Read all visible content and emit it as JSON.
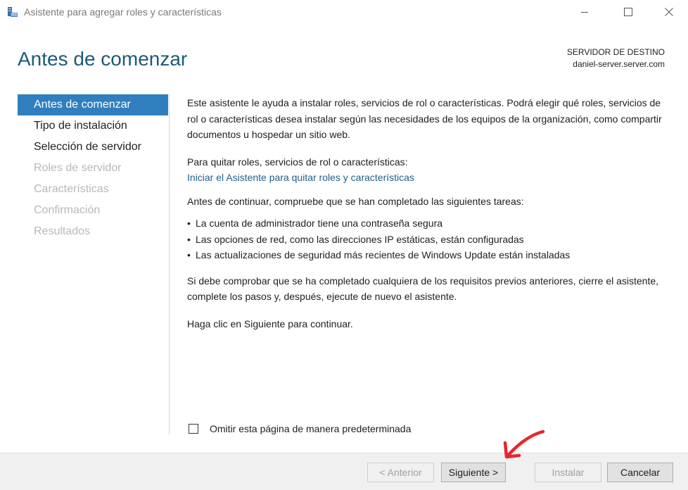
{
  "window": {
    "title": "Asistente para agregar roles y características",
    "icon": "server-manager-icon",
    "controls": [
      "minimize-icon",
      "maximize-icon",
      "close-icon"
    ]
  },
  "header": {
    "heading": "Antes de comenzar",
    "destination_label": "SERVIDOR DE DESTINO",
    "destination_server": "daniel-server.server.com"
  },
  "nav": {
    "items": [
      {
        "label": "Antes de comenzar",
        "state": "active"
      },
      {
        "label": "Tipo de instalación",
        "state": "enabled"
      },
      {
        "label": "Selección de servidor",
        "state": "enabled"
      },
      {
        "label": "Roles de servidor",
        "state": "disabled"
      },
      {
        "label": "Características",
        "state": "disabled"
      },
      {
        "label": "Confirmación",
        "state": "disabled"
      },
      {
        "label": "Resultados",
        "state": "disabled"
      }
    ]
  },
  "content": {
    "intro": "Este asistente le ayuda a instalar roles, servicios de rol o características. Podrá elegir qué roles, servicios de rol o características desea instalar según las necesidades de los equipos de la organización, como compartir documentos u hospedar un sitio web.",
    "remove_text": "Para quitar roles, servicios de rol o características:",
    "remove_link": "Iniciar el Asistente para quitar roles y características",
    "before_text": "Antes de continuar, compruebe que se han completado las siguientes tareas:",
    "tasks": [
      "La cuenta de administrador tiene una contraseña segura",
      "Las opciones de red, como las direcciones IP estáticas, están configuradas",
      "Las actualizaciones de seguridad más recientes de Windows Update están instaladas"
    ],
    "check_text": "Si debe comprobar que se ha completado cualquiera de los requisitos previos anteriores, cierre el asistente, complete los pasos y, después, ejecute de nuevo el asistente.",
    "continue_text": "Haga clic en Siguiente para continuar."
  },
  "skip": {
    "label": "Omitir esta página de manera predeterminada",
    "checked": false
  },
  "footer": {
    "previous": "< Anterior",
    "next": "Siguiente >",
    "install": "Instalar",
    "cancel": "Cancelar"
  },
  "colors": {
    "accent": "#2f7fc0",
    "heading": "#1d5a78",
    "link": "#1f5f8a",
    "annotation": "#e8262d"
  }
}
